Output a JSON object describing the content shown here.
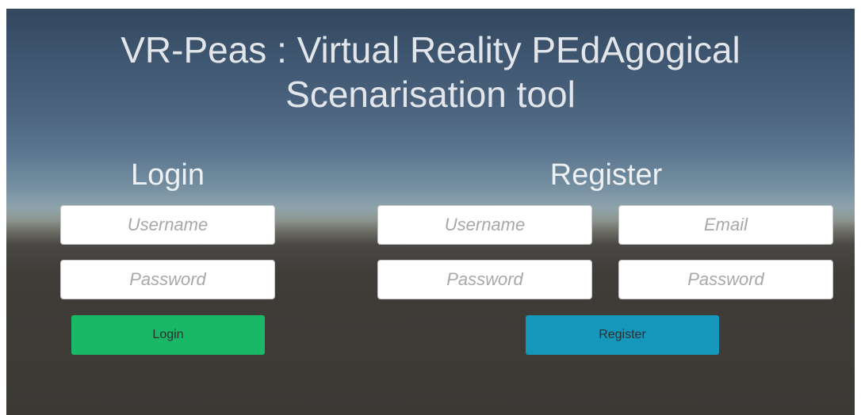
{
  "title": "VR-Peas : Virtual Reality PEdAgogical Scenarisation tool",
  "login": {
    "heading": "Login",
    "username_placeholder": "Username",
    "password_placeholder": "Password",
    "button_label": "Login"
  },
  "register": {
    "heading": "Register",
    "username_placeholder": "Username",
    "email_placeholder": "Email",
    "password_placeholder": "Password",
    "confirm_password_placeholder": "Password",
    "button_label": "Register"
  },
  "colors": {
    "login_button": "#19b866",
    "register_button": "#1597bc"
  }
}
